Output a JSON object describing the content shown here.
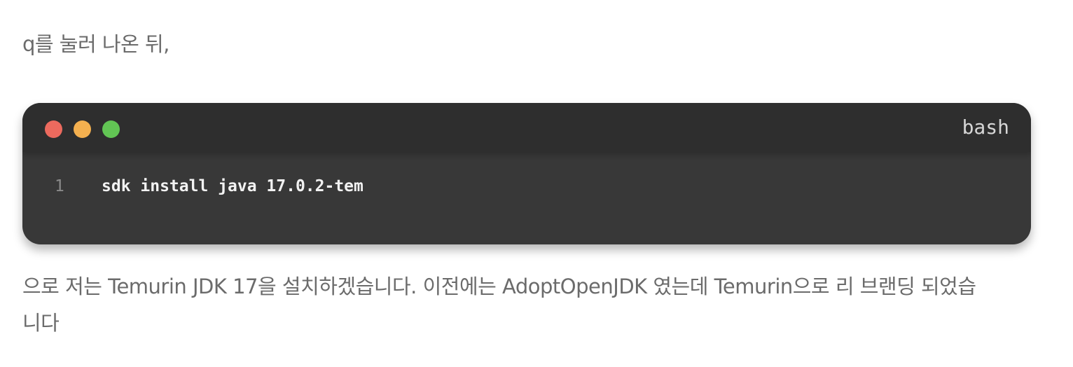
{
  "intro": {
    "text": "q를 눌러 나온 뒤,"
  },
  "code_block": {
    "language": "bash",
    "window_dots": [
      "red",
      "yellow",
      "green"
    ],
    "lines": [
      {
        "number": "1",
        "code": "sdk install java 17.0.2-tem"
      }
    ]
  },
  "outro": {
    "line1": "으로 저는 Temurin JDK 17을 설치하겠습니다. 이전에는 AdoptOpenJDK 였는데 Temurin으로 리 브랜딩 되었습",
    "line2": "니다"
  },
  "colors": {
    "dot_red": "#ec6a5e",
    "dot_yellow": "#f4b04f",
    "dot_green": "#62c554",
    "code_bg": "#383838",
    "code_header_bg": "#2e2e2e",
    "body_text": "#6b6b6b"
  }
}
